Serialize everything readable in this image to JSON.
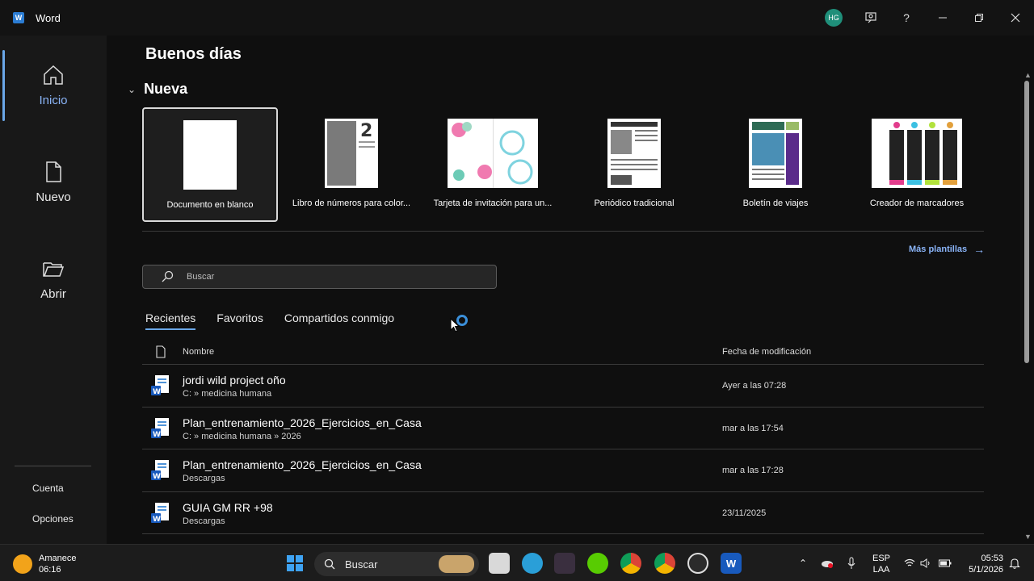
{
  "titlebar": {
    "app_name": "Word",
    "avatar_initials": "HG",
    "help_label": "?"
  },
  "sidebar": {
    "items": [
      {
        "label": "Inicio",
        "icon": "home-icon"
      },
      {
        "label": "Nuevo",
        "icon": "new-document-icon"
      },
      {
        "label": "Abrir",
        "icon": "folder-open-icon"
      }
    ],
    "footer": [
      {
        "label": "Cuenta"
      },
      {
        "label": "Opciones"
      }
    ]
  },
  "main": {
    "greeting": "Buenos días",
    "new_section_title": "Nueva",
    "templates": [
      {
        "name": "Documento en blanco",
        "selected": true
      },
      {
        "name": "Libro de números para color..."
      },
      {
        "name": "Tarjeta de invitación para un..."
      },
      {
        "name": "Periódico tradicional"
      },
      {
        "name": "Boletín de viajes"
      },
      {
        "name": "Creador de marcadores"
      }
    ],
    "more_templates": "Más plantillas",
    "search_placeholder": "Buscar",
    "tabs": [
      {
        "label": "Recientes",
        "active": true
      },
      {
        "label": "Favoritos"
      },
      {
        "label": "Compartidos conmigo"
      }
    ],
    "columns": {
      "name": "Nombre",
      "date": "Fecha de modificación"
    },
    "files": [
      {
        "name": "jordi wild project oño",
        "path": "C: » medicina humana",
        "date": "Ayer a las 07:28"
      },
      {
        "name": "Plan_entrenamiento_2026_Ejercicios_en_Casa",
        "path": "C: » medicina humana » 2026",
        "date": "mar a las 17:54"
      },
      {
        "name": "Plan_entrenamiento_2026_Ejercicios_en_Casa",
        "path": "Descargas",
        "date": "mar a las 17:28"
      },
      {
        "name": "GUIA GM RR +98",
        "path": "Descargas",
        "date": "23/11/2025"
      }
    ]
  },
  "taskbar": {
    "weather_title": "Amanece",
    "weather_time": "06:16",
    "search_label": "Buscar",
    "language": "ESP",
    "layout": "LAA",
    "clock_time": "05:53",
    "clock_date": "5/1/2026"
  },
  "colors": {
    "accent": "#6aa7e8",
    "link": "#8ab4f8",
    "word_blue": "#2b7cd3",
    "avatar": "#1f8f7a"
  }
}
